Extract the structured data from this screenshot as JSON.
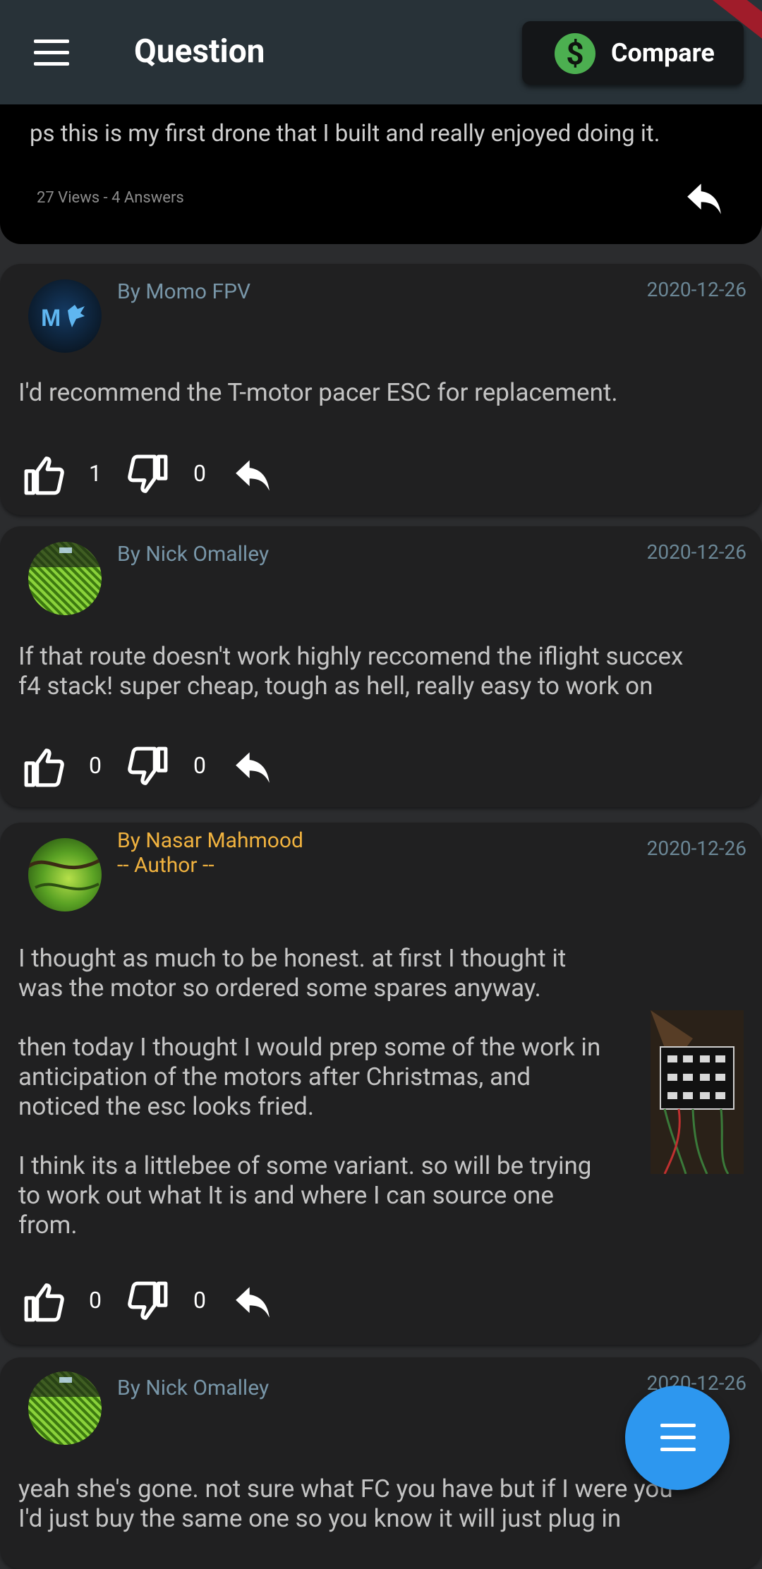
{
  "appbar": {
    "title": "Question",
    "compare_label": "Compare",
    "dollar_symbol": "$",
    "accent": "#4caf50"
  },
  "question": {
    "text": "ps this is my first drone that I built and really enjoyed doing it.",
    "stats": "27 Views - 4 Answers"
  },
  "answers": [
    {
      "author": "By Momo FPV",
      "date": "2020-12-26",
      "body": "I'd recommend the T-motor pacer ESC for replacement.",
      "likes": "1",
      "dislikes": "0"
    },
    {
      "author": "By Nick Omalley",
      "date": "2020-12-26",
      "body": "If that route doesn't work highly reccomend the iflight succex\nf4 stack! super cheap, tough as hell, really easy to work on",
      "likes": "0",
      "dislikes": "0"
    },
    {
      "author": "By Nasar Mahmood",
      "author_tag": "-- Author --",
      "date": "2020-12-26",
      "body": "I thought as much to be honest. at first I thought it\nwas the motor so ordered some spares anyway.\n\nthen today I thought I would prep some of the work in\nanticipation of the motors after Christmas, and\nnoticed the esc looks fried.\n\nI think its a littlebee of some variant. so will be trying\nto work out what It is and where I can source one\nfrom.",
      "likes": "0",
      "dislikes": "0"
    },
    {
      "author": "By Nick Omalley",
      "date": "2020-12-26",
      "body": "yeah she's gone. not sure what FC you have but if I were you\nI'd just buy the same one so you know it will just plug in"
    }
  ],
  "colors": {
    "appbar": "#283238",
    "card": "#202021",
    "background": "#2b2c2e",
    "author": "#7896a8",
    "op_author": "#f0b23f",
    "fab": "#2d97ef"
  }
}
